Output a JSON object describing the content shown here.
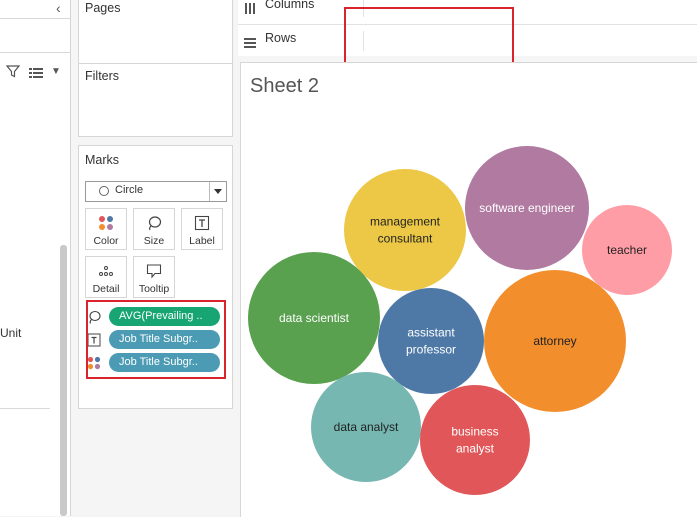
{
  "shelves": {
    "pages_title": "Pages",
    "filters_title": "Filters",
    "marks_title": "Marks",
    "columns_label": "Columns",
    "rows_label": "Rows"
  },
  "data_pane": {
    "field_text": "Unit"
  },
  "marks": {
    "type": "Circle",
    "buttons": [
      {
        "label": "Color",
        "icon": "color-dots-icon"
      },
      {
        "label": "Size",
        "icon": "size-lasso-icon"
      },
      {
        "label": "Label",
        "icon": "text-label-icon"
      },
      {
        "label": "Detail",
        "icon": "detail-dots-icon"
      },
      {
        "label": "Tooltip",
        "icon": "tooltip-icon"
      }
    ],
    "pills": [
      {
        "text": "AVG(Prevailing ..",
        "type": "size",
        "color": "#17a673"
      },
      {
        "text": "Job Title Subgr..",
        "type": "label",
        "color": "#4b9bb5"
      },
      {
        "text": "Job Title Subgr..",
        "type": "color",
        "color": "#4b9bb5"
      }
    ]
  },
  "sheet": {
    "title": "Sheet 2"
  },
  "chart_data": {
    "type": "packed-bubble",
    "size_field": "AVG(Prevailing ..",
    "label_field": "Job Title Subgr..",
    "bubbles": [
      {
        "label": "management\nconsultant",
        "color": "#ecc846"
      },
      {
        "label": "software engineer",
        "color": "#b07aa1"
      },
      {
        "label": "teacher",
        "color": "#ff9da7"
      },
      {
        "label": "data scientist",
        "color": "#59a14f"
      },
      {
        "label": "assistant\nprofessor",
        "color": "#4e79a7"
      },
      {
        "label": "attorney",
        "color": "#f28e2b"
      },
      {
        "label": "data analyst",
        "color": "#76b7b2"
      },
      {
        "label": "business\nanalyst",
        "color": "#e15759"
      }
    ]
  }
}
